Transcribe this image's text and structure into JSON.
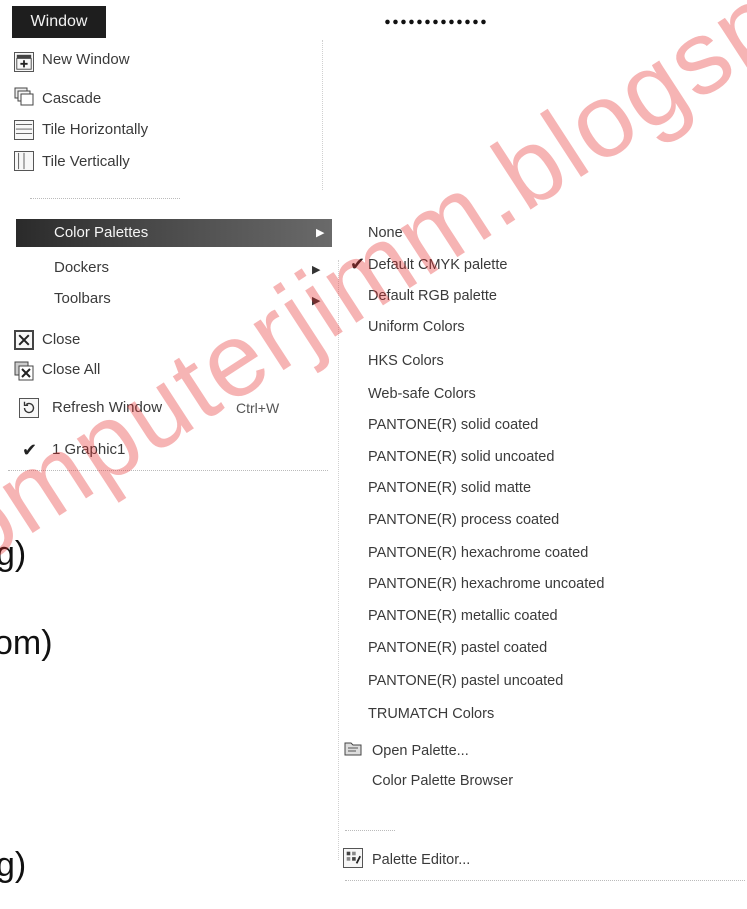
{
  "header": {
    "text": "............."
  },
  "window_menu": {
    "title": "Window",
    "items": [
      {
        "label": "New Window",
        "icon": "new-window-icon"
      },
      {
        "label": "Cascade",
        "icon": "cascade-icon"
      },
      {
        "label": "Tile Horizontally",
        "icon": "tile-horizontally-icon"
      },
      {
        "label": "Tile Vertically",
        "icon": "tile-vertically-icon"
      }
    ],
    "color_palettes": "Color Palettes",
    "dockers": "Dockers",
    "toolbars": "Toolbars",
    "close": "Close",
    "close_all": "Close All",
    "refresh": "Refresh Window",
    "refresh_shortcut": "Ctrl+W",
    "graphic": "1 Graphic1"
  },
  "palette_submenu": {
    "items": [
      {
        "label": "None",
        "checked": false
      },
      {
        "label": "Default CMYK palette",
        "checked": true
      },
      {
        "label": "Default RGB palette",
        "checked": false
      },
      {
        "label": "Uniform Colors",
        "checked": false
      },
      {
        "label": "HKS Colors",
        "checked": false
      },
      {
        "label": "Web-safe Colors",
        "checked": false
      },
      {
        "label": "PANTONE(R) solid coated",
        "checked": false
      },
      {
        "label": "PANTONE(R) solid uncoated",
        "checked": false
      },
      {
        "label": "PANTONE(R) solid matte",
        "checked": false
      },
      {
        "label": "PANTONE(R) process coated",
        "checked": false
      },
      {
        "label": "PANTONE(R) hexachrome coated",
        "checked": false
      },
      {
        "label": "PANTONE(R) hexachrome uncoated",
        "checked": false
      },
      {
        "label": "PANTONE(R) metallic coated",
        "checked": false
      },
      {
        "label": "PANTONE(R) pastel coated",
        "checked": false
      },
      {
        "label": "PANTONE(R) pastel uncoated",
        "checked": false
      },
      {
        "label": "TRUMATCH Colors",
        "checked": false
      }
    ],
    "open_palette": "Open Palette...",
    "browser": "Color Palette Browser",
    "editor": "Palette Editor..."
  },
  "background_fragments": {
    "line1": "g)",
    "line2": "om)",
    "line3": "g)"
  },
  "watermark": {
    "text": "computerjimm.blogspot.com",
    "color": "#e62828"
  }
}
